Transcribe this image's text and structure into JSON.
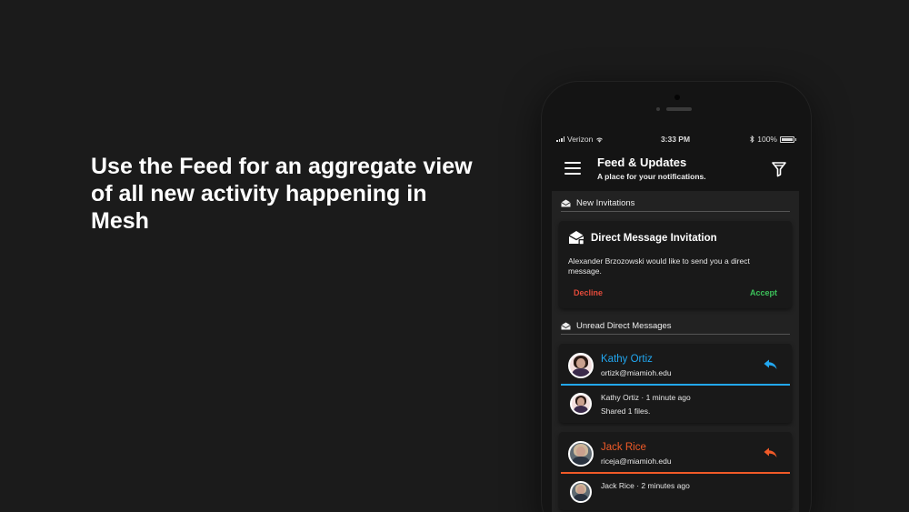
{
  "headline": "Use the Feed for an aggregate view of all new activity happening in Mesh",
  "status_bar": {
    "carrier": "Verizon",
    "time": "3:33 PM",
    "battery": "100%"
  },
  "app_bar": {
    "title": "Feed & Updates",
    "subtitle": "A place for your notifications."
  },
  "sections": {
    "invitations": {
      "label": "New Invitations"
    },
    "unread": {
      "label": "Unread Direct Messages"
    }
  },
  "invitation": {
    "title": "Direct Message Invitation",
    "body": "Alexander Brzozowski would like to send you a direct message.",
    "decline_label": "Decline",
    "accept_label": "Accept"
  },
  "messages": [
    {
      "name": "Kathy Ortiz",
      "email": "ortizk@miamioh.edu",
      "accent": "#22a7f0",
      "msg_meta": "Kathy Ortiz · 1 minute ago",
      "msg_body": "Shared 1 files."
    },
    {
      "name": "Jack Rice",
      "email": "riceja@miamioh.edu",
      "accent": "#f05a28",
      "msg_meta": "Jack Rice · 2 minutes ago",
      "msg_body": ""
    }
  ],
  "icons": {
    "menu": "hamburger-icon",
    "filter": "filter-icon",
    "envelope": "envelope-open-icon",
    "reply": "reply-icon"
  }
}
